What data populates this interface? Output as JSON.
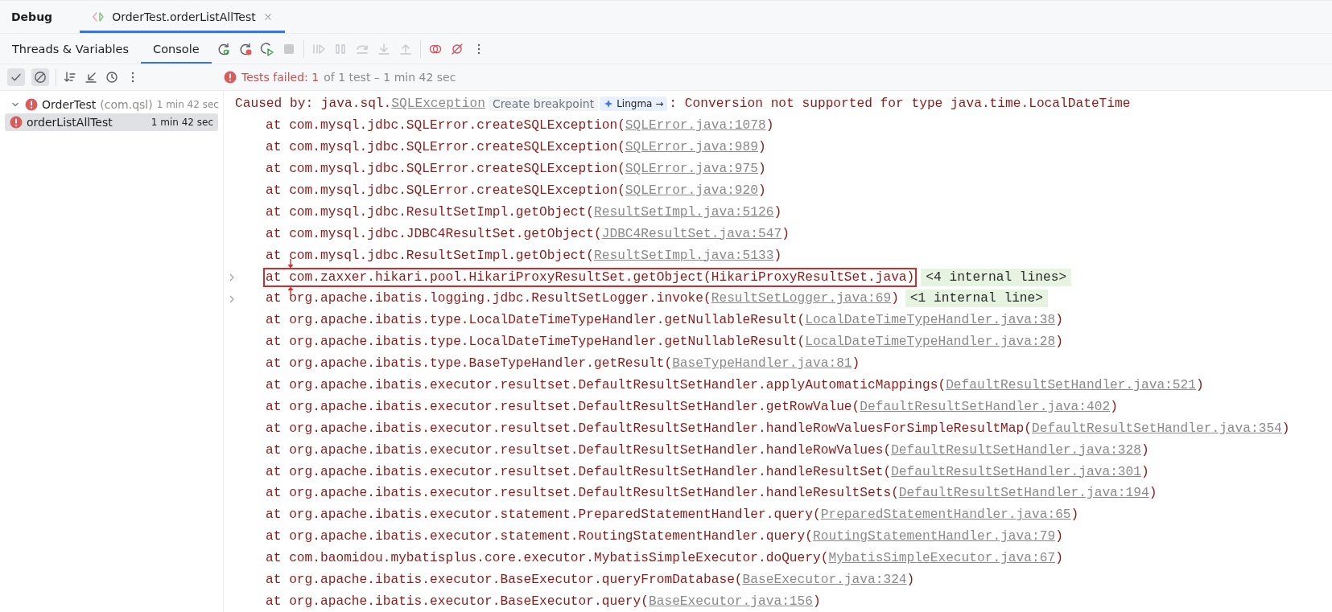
{
  "tool_window": {
    "title": "Debug",
    "tab": {
      "label": "OrderTest.orderListAllTest",
      "selected": true
    }
  },
  "view_tabs": [
    {
      "label": "Threads & Variables",
      "selected": false
    },
    {
      "label": "Console",
      "selected": true
    }
  ],
  "filters": [
    {
      "kind": "passed",
      "selected": true
    },
    {
      "kind": "ignored",
      "selected": true
    }
  ],
  "status": {
    "failed": "Tests failed: 1",
    "rest": "of 1 test – 1 min 42 sec"
  },
  "tree": [
    {
      "name": "OrderTest",
      "package": "(com.qsl)",
      "time": "1 min 42 sec",
      "expanded": true,
      "selected": false,
      "children": [
        {
          "name": "orderListAllTest",
          "time": "1 min 42 sec",
          "selected": true
        }
      ]
    }
  ],
  "console": [
    {
      "kind": "cause",
      "prefix": "Caused by: java.sql.",
      "link": "SQLException",
      "hint": "Create breakpoint",
      "badge": "Lingma →",
      "message": ": Conversion not supported for type java.time.LocalDateTime"
    },
    {
      "kind": "frame",
      "call": "at com.mysql.jdbc.SQLError.createSQLException(",
      "link": "SQLError.java:1078",
      "close": ")",
      "highlighted": false
    },
    {
      "kind": "frame",
      "call": "at com.mysql.jdbc.SQLError.createSQLException(",
      "link": "SQLError.java:989",
      "close": ")",
      "highlighted": false
    },
    {
      "kind": "frame",
      "call": "at com.mysql.jdbc.SQLError.createSQLException(",
      "link": "SQLError.java:975",
      "close": ")",
      "highlighted": false
    },
    {
      "kind": "frame",
      "call": "at com.mysql.jdbc.SQLError.createSQLException(",
      "link": "SQLError.java:920",
      "close": ")",
      "highlighted": false
    },
    {
      "kind": "frame",
      "call": "at com.mysql.jdbc.ResultSetImpl.getObject(",
      "link": "ResultSetImpl.java:5126",
      "close": ")",
      "highlighted": false
    },
    {
      "kind": "frame",
      "call": "at com.mysql.jdbc.JDBC4ResultSet.getObject(",
      "link": "JDBC4ResultSet.java:547",
      "close": ")",
      "highlighted": false
    },
    {
      "kind": "frame",
      "call": "at com.mysql.jdbc.ResultSetImpl.getObject(",
      "link": "ResultSetImpl.java:5133",
      "close": ")",
      "highlighted": false
    },
    {
      "kind": "frame",
      "call": "at com.zaxxer.hikari.pool.HikariProxyResultSet.getObject(HikariProxyResultSet.java)",
      "fold": "<4 internal lines>",
      "highlighted": true
    },
    {
      "kind": "frame",
      "call": "at org.apache.ibatis.logging.jdbc.ResultSetLogger.invoke(",
      "link": "ResultSetLogger.java:69",
      "close": ")",
      "fold": "<1 internal line>",
      "highlighted": false
    },
    {
      "kind": "frame",
      "call": "at org.apache.ibatis.type.LocalDateTimeTypeHandler.getNullableResult(",
      "link": "LocalDateTimeTypeHandler.java:38",
      "close": ")",
      "highlighted": false
    },
    {
      "kind": "frame",
      "call": "at org.apache.ibatis.type.LocalDateTimeTypeHandler.getNullableResult(",
      "link": "LocalDateTimeTypeHandler.java:28",
      "close": ")",
      "highlighted": false
    },
    {
      "kind": "frame",
      "call": "at org.apache.ibatis.type.BaseTypeHandler.getResult(",
      "link": "BaseTypeHandler.java:81",
      "close": ")",
      "highlighted": false
    },
    {
      "kind": "frame",
      "call": "at org.apache.ibatis.executor.resultset.DefaultResultSetHandler.applyAutomaticMappings(",
      "link": "DefaultResultSetHandler.java:521",
      "close": ")",
      "highlighted": false
    },
    {
      "kind": "frame",
      "call": "at org.apache.ibatis.executor.resultset.DefaultResultSetHandler.getRowValue(",
      "link": "DefaultResultSetHandler.java:402",
      "close": ")",
      "highlighted": false
    },
    {
      "kind": "frame",
      "call": "at org.apache.ibatis.executor.resultset.DefaultResultSetHandler.handleRowValuesForSimpleResultMap(",
      "link": "DefaultResultSetHandler.java:354",
      "close": ")",
      "highlighted": false
    },
    {
      "kind": "frame",
      "call": "at org.apache.ibatis.executor.resultset.DefaultResultSetHandler.handleRowValues(",
      "link": "DefaultResultSetHandler.java:328",
      "close": ")",
      "highlighted": false
    },
    {
      "kind": "frame",
      "call": "at org.apache.ibatis.executor.resultset.DefaultResultSetHandler.handleResultSet(",
      "link": "DefaultResultSetHandler.java:301",
      "close": ")",
      "highlighted": false
    },
    {
      "kind": "frame",
      "call": "at org.apache.ibatis.executor.resultset.DefaultResultSetHandler.handleResultSets(",
      "link": "DefaultResultSetHandler.java:194",
      "close": ")",
      "highlighted": false
    },
    {
      "kind": "frame",
      "call": "at org.apache.ibatis.executor.statement.PreparedStatementHandler.query(",
      "link": "PreparedStatementHandler.java:65",
      "close": ")",
      "highlighted": false
    },
    {
      "kind": "frame",
      "call": "at org.apache.ibatis.executor.statement.RoutingStatementHandler.query(",
      "link": "RoutingStatementHandler.java:79",
      "close": ")",
      "highlighted": false
    },
    {
      "kind": "frame",
      "call": "at com.baomidou.mybatisplus.core.executor.MybatisSimpleExecutor.doQuery(",
      "link": "MybatisSimpleExecutor.java:67",
      "close": ")",
      "highlighted": false
    },
    {
      "kind": "frame",
      "call": "at org.apache.ibatis.executor.BaseExecutor.queryFromDatabase(",
      "link": "BaseExecutor.java:324",
      "close": ")",
      "highlighted": false
    },
    {
      "kind": "frame",
      "call": "at org.apache.ibatis.executor.BaseExecutor.query(",
      "link": "BaseExecutor.java:156",
      "close": ")",
      "highlighted": false
    }
  ]
}
